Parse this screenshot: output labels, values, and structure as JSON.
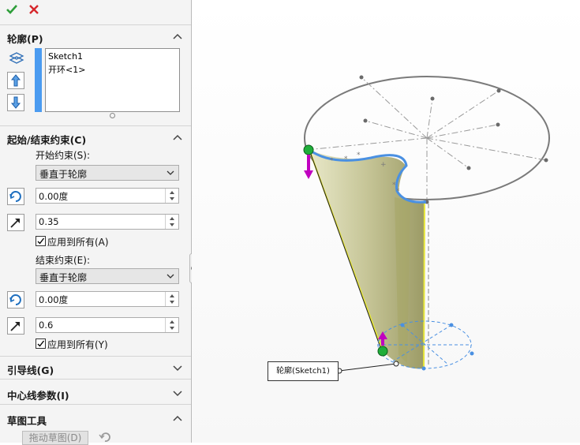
{
  "toolbar": {
    "ok_icon": "checkmark-icon",
    "cancel_icon": "close-icon",
    "ok_color": "#2e9e3a",
    "cancel_color": "#d6262b"
  },
  "profile": {
    "title": "轮廓(P)",
    "items": [
      "Sketch1",
      "开环<1>"
    ]
  },
  "constraints": {
    "title": "起始/结束约束(C)",
    "start_label": "开始约束(S):",
    "start_type": "垂直于轮廓",
    "start_angle": "0.00度",
    "start_length": "0.35",
    "start_apply_all": "应用到所有(A)",
    "end_label": "结束约束(E):",
    "end_type": "垂直于轮廓",
    "end_angle": "0.00度",
    "end_length": "0.6",
    "end_apply_all": "应用到所有(Y)"
  },
  "guide_curves": {
    "title": "引导线(G)"
  },
  "centerline": {
    "title": "中心线参数(I)"
  },
  "sketch_tools": {
    "title": "草图工具",
    "drag_sketch": "拖动草图(D)"
  },
  "viewport": {
    "callout": "轮廓(Sketch1)",
    "accent": "#4a90e2",
    "surface_color": "#c8c79a"
  }
}
